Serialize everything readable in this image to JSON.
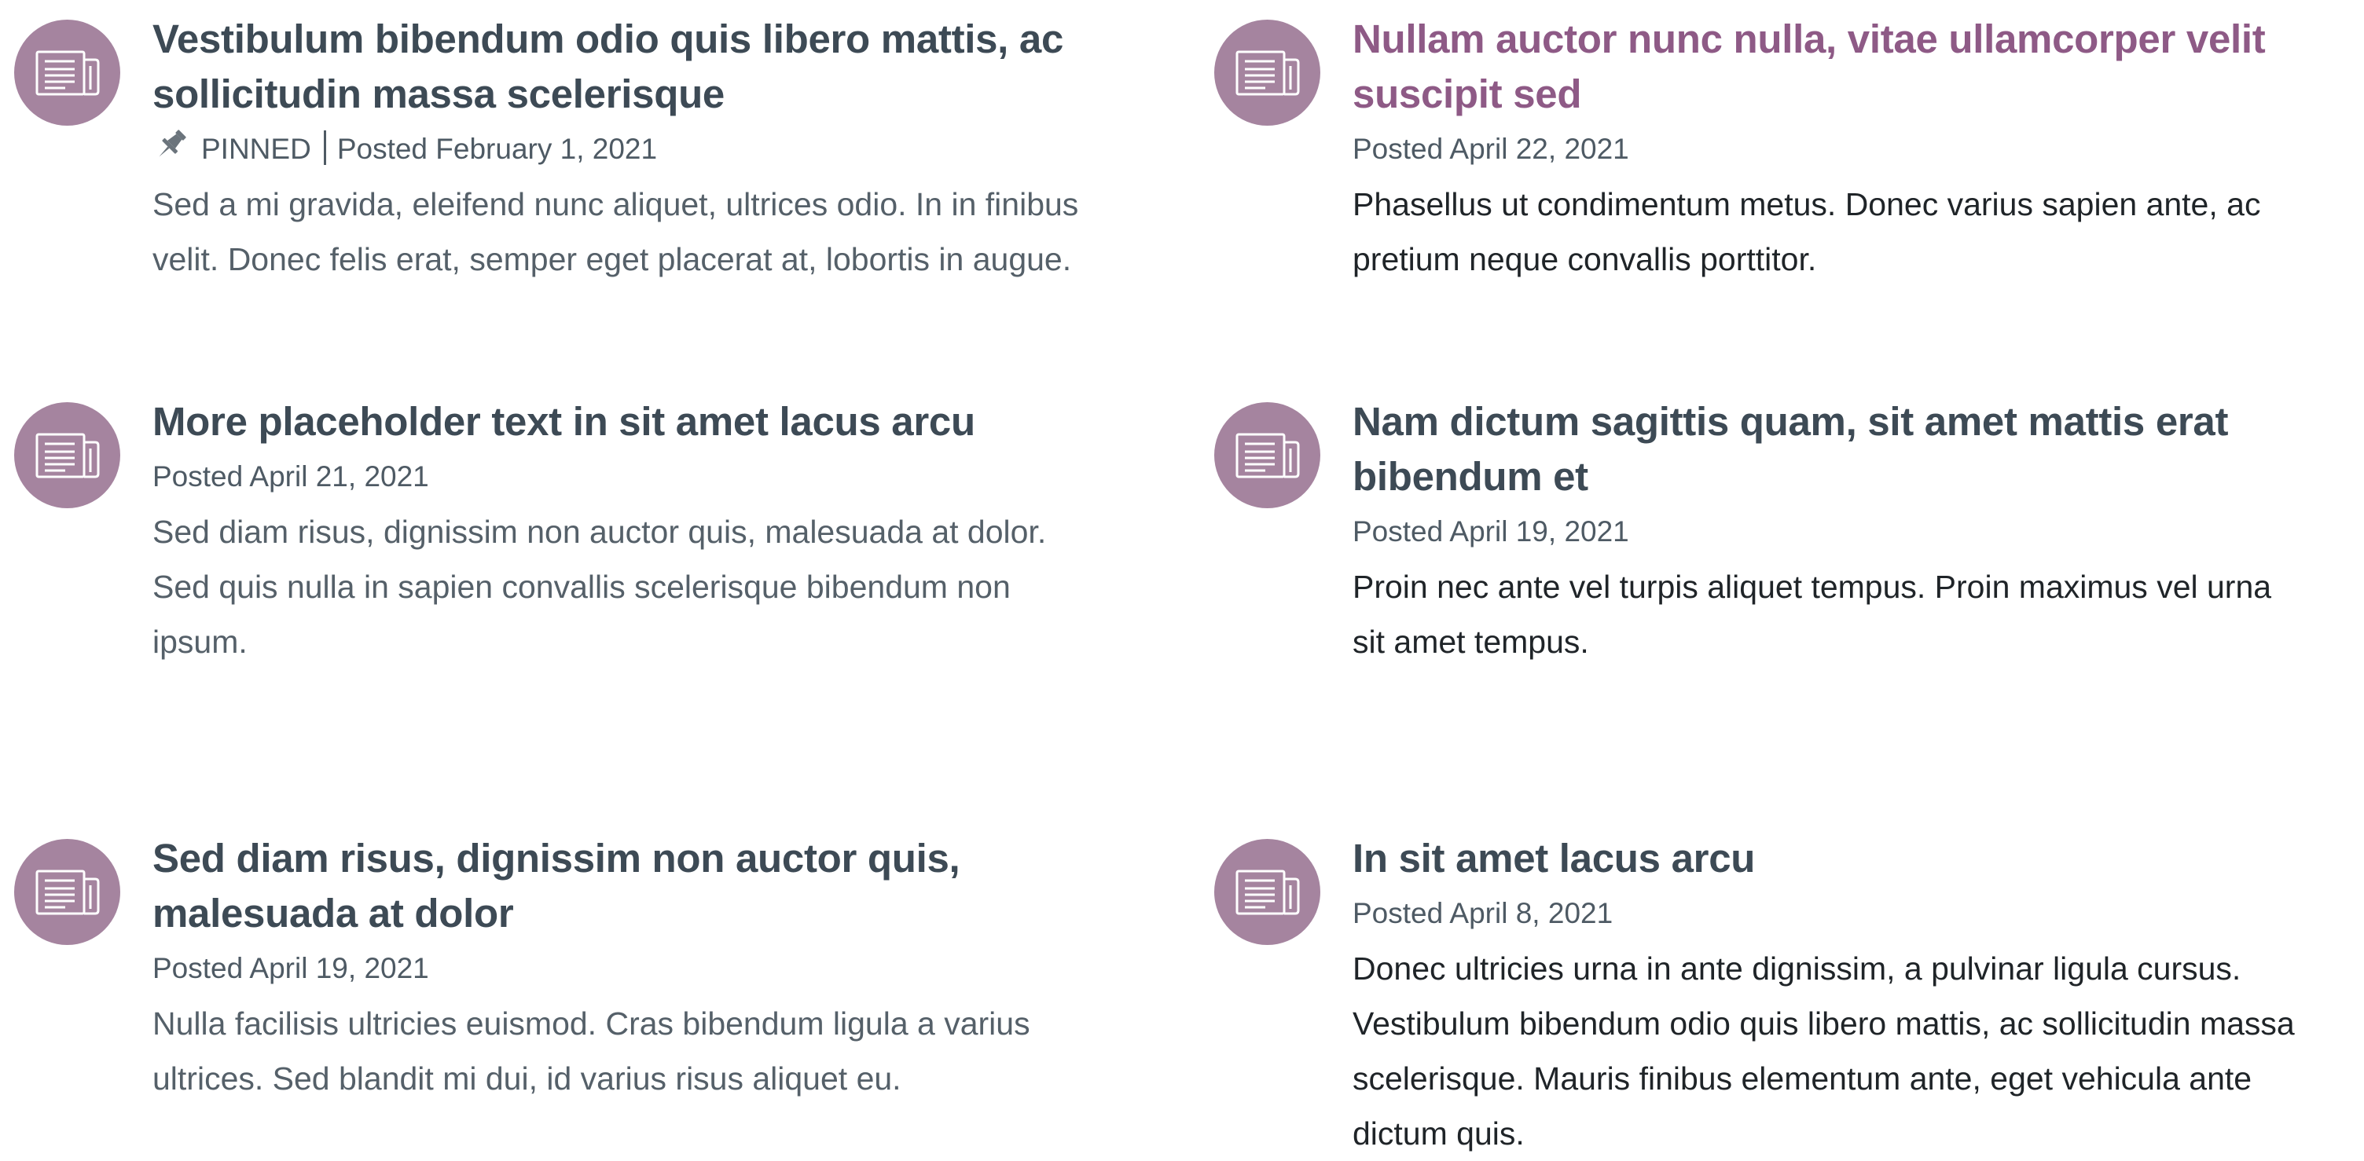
{
  "colors": {
    "icon_circle": "#a5849f",
    "title": "#3d4a55",
    "title_active": "#8e5a86",
    "meta": "#4e5a64",
    "excerpt": "#556069",
    "excerpt_dark": "#1f2428"
  },
  "icons": {
    "item": "newspaper-icon",
    "pinned": "pushpin-icon"
  },
  "news": [
    {
      "title": "Vestibulum bibendum odio quis libero mattis, ac sollicitudin massa scelerisque",
      "pinned_label": "PINNED",
      "date": "Posted February 1, 2021",
      "excerpt": "Sed a mi gravida, eleifend nunc aliquet, ultrices odio. In in finibus velit. Donec felis erat, semper eget placerat at, lobortis in augue."
    },
    {
      "title": "Nullam auctor nunc nulla, vitae ullamcorper velit suscipit sed",
      "date": "Posted April 22, 2021",
      "excerpt": "Phasellus ut condimentum metus. Donec varius sapien ante, ac pretium neque convallis porttitor."
    },
    {
      "title": "More placeholder text in sit amet lacus arcu",
      "date": "Posted April 21, 2021",
      "excerpt": "Sed diam risus, dignissim non auctor quis, malesuada at dolor. Sed quis nulla in sapien convallis scelerisque bibendum non ipsum."
    },
    {
      "title": "Nam dictum sagittis quam, sit amet mattis erat bibendum et",
      "date": "Posted April 19, 2021",
      "excerpt": "Proin nec ante vel turpis aliquet tempus. Proin maximus vel urna sit amet tempus."
    },
    {
      "title": "Sed diam risus, dignissim non auctor quis, malesuada at dolor",
      "date": "Posted April 19, 2021",
      "excerpt": "Nulla facilisis ultricies euismod. Cras bibendum ligula a varius ultrices. Sed blandit mi dui, id varius risus aliquet eu."
    },
    {
      "title": "In sit amet lacus arcu",
      "date": "Posted April 8, 2021",
      "excerpt": "Donec ultricies urna in ante dignissim, a pulvinar ligula cursus. Vestibulum bibendum odio quis libero mattis, ac sollicitudin massa scelerisque. Mauris finibus elementum ante, eget vehicula ante dictum quis."
    }
  ]
}
